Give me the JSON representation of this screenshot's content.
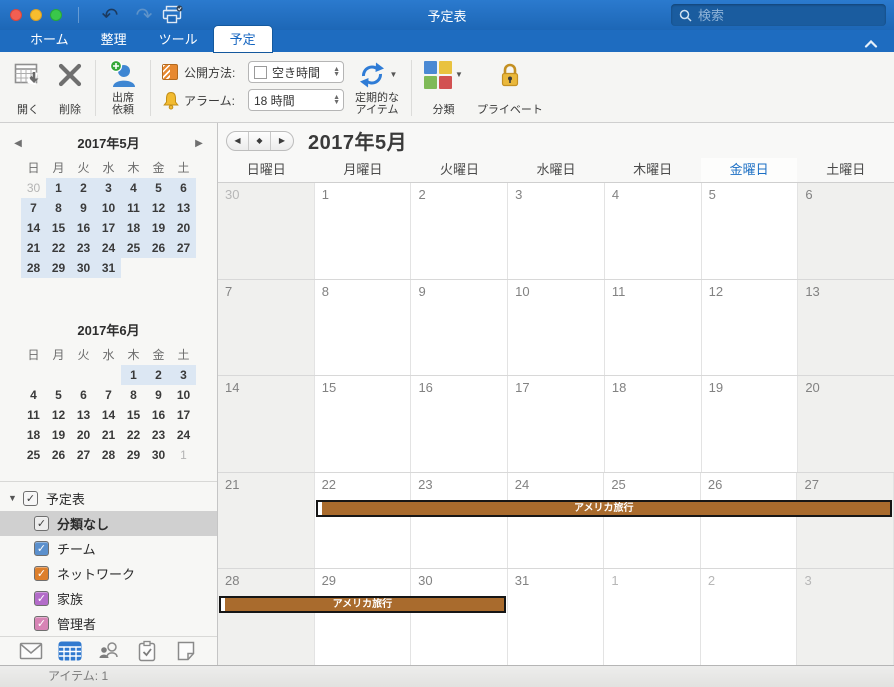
{
  "titlebar": {
    "title": "予定表",
    "search_placeholder": "検索",
    "icons": [
      "undo-icon",
      "redo-icon",
      "print-icon",
      "search-icon"
    ]
  },
  "tabs": [
    {
      "label": "ホーム",
      "active": false
    },
    {
      "label": "整理",
      "active": false
    },
    {
      "label": "ツール",
      "active": false
    },
    {
      "label": "予定",
      "active": true
    }
  ],
  "ribbon": {
    "open_label": "開く",
    "delete_label": "削除",
    "invite_label": [
      "出席",
      "依頼"
    ],
    "show_as_label": "公開方法:",
    "show_as_value": "空き時間",
    "reminder_label": "アラーム:",
    "reminder_value": "18 時間",
    "recurrence_label": [
      "定期的な",
      "アイテム"
    ],
    "categorize_label": "分類",
    "private_label": "プライベート",
    "category_colors": [
      "#4a89d4",
      "#e9c23f",
      "#7fba57",
      "#d25151"
    ]
  },
  "sidebar": {
    "mini_calendars": [
      {
        "title": "2017年5月",
        "has_arrows": true,
        "day_headers": [
          "日",
          "月",
          "火",
          "水",
          "木",
          "金",
          "土"
        ],
        "weeks": [
          [
            {
              "d": 30,
              "other": true
            },
            {
              "d": 1,
              "hl": true
            },
            {
              "d": 2,
              "hl": true
            },
            {
              "d": 3,
              "hl": true
            },
            {
              "d": 4,
              "hl": true
            },
            {
              "d": 5,
              "hl": true
            },
            {
              "d": 6,
              "hl": true
            }
          ],
          [
            {
              "d": 7,
              "hl": true
            },
            {
              "d": 8,
              "hl": true
            },
            {
              "d": 9,
              "hl": true
            },
            {
              "d": 10,
              "hl": true
            },
            {
              "d": 11,
              "hl": true
            },
            {
              "d": 12,
              "hl": true
            },
            {
              "d": 13,
              "hl": true
            }
          ],
          [
            {
              "d": 14,
              "hl": true
            },
            {
              "d": 15,
              "hl": true
            },
            {
              "d": 16,
              "hl": true
            },
            {
              "d": 17,
              "hl": true
            },
            {
              "d": 18,
              "hl": true
            },
            {
              "d": 19,
              "hl": true
            },
            {
              "d": 20,
              "hl": true
            }
          ],
          [
            {
              "d": 21,
              "hl": true
            },
            {
              "d": 22,
              "hl": true
            },
            {
              "d": 23,
              "hl": true
            },
            {
              "d": 24,
              "hl": true
            },
            {
              "d": 25,
              "hl": true
            },
            {
              "d": 26,
              "hl": true
            },
            {
              "d": 27,
              "hl": true
            }
          ],
          [
            {
              "d": 28,
              "hl": true
            },
            {
              "d": 29,
              "hl": true
            },
            {
              "d": 30,
              "hl": true
            },
            {
              "d": 31,
              "hl": true
            },
            null,
            null,
            null
          ]
        ]
      },
      {
        "title": "2017年6月",
        "has_arrows": false,
        "day_headers": [
          "日",
          "月",
          "火",
          "水",
          "木",
          "金",
          "土"
        ],
        "weeks": [
          [
            null,
            null,
            null,
            null,
            {
              "d": 1,
              "hl": true
            },
            {
              "d": 2,
              "hl": true
            },
            {
              "d": 3,
              "hl": true
            }
          ],
          [
            {
              "d": 4
            },
            {
              "d": 5
            },
            {
              "d": 6
            },
            {
              "d": 7
            },
            {
              "d": 8
            },
            {
              "d": 9
            },
            {
              "d": 10
            }
          ],
          [
            {
              "d": 11
            },
            {
              "d": 12
            },
            {
              "d": 13
            },
            {
              "d": 14
            },
            {
              "d": 15
            },
            {
              "d": 16
            },
            {
              "d": 17
            }
          ],
          [
            {
              "d": 18
            },
            {
              "d": 19
            },
            {
              "d": 20
            },
            {
              "d": 21
            },
            {
              "d": 22
            },
            {
              "d": 23
            },
            {
              "d": 24
            }
          ],
          [
            {
              "d": 25
            },
            {
              "d": 26
            },
            {
              "d": 27
            },
            {
              "d": 28
            },
            {
              "d": 29
            },
            {
              "d": 30
            },
            {
              "d": 1,
              "other": true
            }
          ]
        ]
      }
    ],
    "calendar_list": {
      "root": {
        "label": "予定表",
        "checked": true,
        "color": "#f6f6f6",
        "check_dark": true
      },
      "items": [
        {
          "label": "分類なし",
          "checked": true,
          "color": "#ececec",
          "check_dark": true,
          "selected": true
        },
        {
          "label": "チーム",
          "checked": true,
          "color": "#5b90cd",
          "check_dark": false,
          "selected": false
        },
        {
          "label": "ネットワーク",
          "checked": true,
          "color": "#dd7f2b",
          "check_dark": false,
          "selected": false
        },
        {
          "label": "家族",
          "checked": true,
          "color": "#b36cc9",
          "check_dark": false,
          "selected": false
        },
        {
          "label": "管理者",
          "checked": true,
          "color": "#d784b5",
          "check_dark": false,
          "selected": false
        }
      ]
    },
    "nav_icons": [
      {
        "name": "mail-icon",
        "active": false
      },
      {
        "name": "calendar-icon",
        "active": true
      },
      {
        "name": "contacts-icon",
        "active": false
      },
      {
        "name": "tasks-icon",
        "active": false
      },
      {
        "name": "notes-icon",
        "active": false
      }
    ]
  },
  "main": {
    "title": "2017年5月",
    "nav_glyphs": [
      "◀",
      "◆",
      "▶"
    ],
    "day_headers": [
      {
        "label": "日曜日",
        "today": false
      },
      {
        "label": "月曜日",
        "today": false
      },
      {
        "label": "火曜日",
        "today": false
      },
      {
        "label": "水曜日",
        "today": false
      },
      {
        "label": "木曜日",
        "today": false
      },
      {
        "label": "金曜日",
        "today": true
      },
      {
        "label": "土曜日",
        "today": false
      }
    ],
    "weeks": [
      [
        {
          "d": 30,
          "other": true
        },
        {
          "d": 1
        },
        {
          "d": 2
        },
        {
          "d": 3
        },
        {
          "d": 4
        },
        {
          "d": 5
        },
        {
          "d": 6
        }
      ],
      [
        {
          "d": 7
        },
        {
          "d": 8
        },
        {
          "d": 9
        },
        {
          "d": 10
        },
        {
          "d": 11
        },
        {
          "d": 12
        },
        {
          "d": 13
        }
      ],
      [
        {
          "d": 14
        },
        {
          "d": 15
        },
        {
          "d": 16
        },
        {
          "d": 17
        },
        {
          "d": 18
        },
        {
          "d": 19
        },
        {
          "d": 20
        }
      ],
      [
        {
          "d": 21
        },
        {
          "d": 22
        },
        {
          "d": 23
        },
        {
          "d": 24
        },
        {
          "d": 25
        },
        {
          "d": 26
        },
        {
          "d": 27
        }
      ],
      [
        {
          "d": 28
        },
        {
          "d": 29
        },
        {
          "d": 30
        },
        {
          "d": 31
        },
        {
          "d": 1,
          "other": true
        },
        {
          "d": 2,
          "other": true
        },
        {
          "d": 3,
          "other": true
        }
      ]
    ],
    "events": [
      {
        "label": "アメリカ旅行",
        "week": 3,
        "start_col": 1,
        "span": 6,
        "color": "#a96b2d"
      },
      {
        "label": "アメリカ旅行",
        "week": 4,
        "start_col": 0,
        "span": 3,
        "color": "#a96b2d"
      }
    ]
  },
  "statusbar": {
    "items_label": "アイテム: 1"
  }
}
